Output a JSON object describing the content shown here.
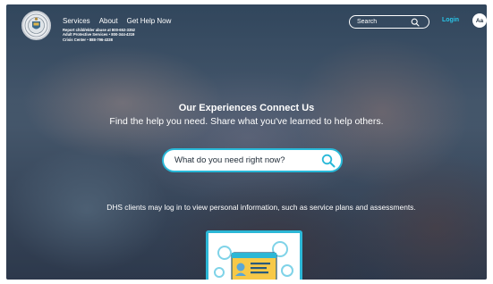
{
  "nav": {
    "logo_icon": "state-seal-icon",
    "items": [
      {
        "label": "Services"
      },
      {
        "label": "About"
      },
      {
        "label": "Get Help Now"
      }
    ],
    "hotlines": [
      "Report child/elder abuse at 800-652-3352",
      "Adult Protective Services • 800-344-4319",
      "Crisis Center • 888-796-4338"
    ],
    "search_placeholder": "Search",
    "search_icon": "magnifier-icon",
    "login_label": "Login",
    "text_size_label": "Aa"
  },
  "hero": {
    "title": "Our Experiences Connect Us",
    "subtitle": "Find the help you need. Share what you've learned to help others.",
    "search_placeholder": "What do you need right now?",
    "search_icon": "magnifier-icon"
  },
  "info": {
    "text": "DHS clients may log in to view personal information, such as service plans and assessments."
  },
  "card": {
    "icon": "profile-card-gears-icon"
  },
  "colors": {
    "accent": "#28b8d8",
    "login": "#29c3e6",
    "card_fill": "#f7c948"
  }
}
